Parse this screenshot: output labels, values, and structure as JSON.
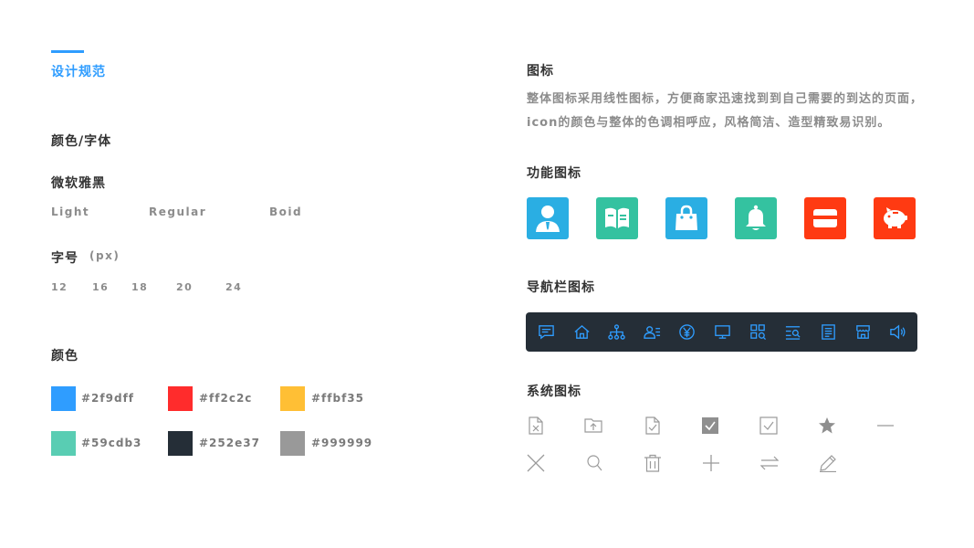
{
  "page": {
    "title": "设计规范"
  },
  "left": {
    "section_color_font": "颜色/字体",
    "font_name": "微软雅黑",
    "weights": [
      "Light",
      "Regular",
      "Boid"
    ],
    "size_title": "字号",
    "size_unit": "(px)",
    "sizes": [
      "12",
      "16",
      "18",
      "20",
      "24"
    ],
    "section_colors": "颜色",
    "colors": [
      {
        "hex": "#2f9dff",
        "label": "#2f9dff"
      },
      {
        "hex": "#ff2c2c",
        "label": "#ff2c2c"
      },
      {
        "hex": "#ffbf35",
        "label": "#ffbf35"
      },
      {
        "hex": "#59cdb3",
        "label": "#59cdb3"
      },
      {
        "hex": "#252e37",
        "label": "#252e37"
      },
      {
        "hex": "#999999",
        "label": "#999999"
      }
    ]
  },
  "right": {
    "section_icons": "图标",
    "desc_line1": "整体图标采用线性图标，方便商家迅速找到到自己需要的到达的页面，",
    "desc_line2": "icon的颜色与整体的色调相呼应，风格简洁、造型精致易识别。",
    "section_function": "功能图标",
    "function_icons": [
      {
        "name": "user-icon",
        "color": "#2aaee3"
      },
      {
        "name": "book-icon",
        "color": "#34c2a0"
      },
      {
        "name": "shopping-bag-icon",
        "color": "#2aaee3"
      },
      {
        "name": "bell-icon",
        "color": "#34c2a0"
      },
      {
        "name": "card-icon",
        "color": "#ff3a12"
      },
      {
        "name": "piggy-bank-icon",
        "color": "#ff3a12"
      }
    ],
    "section_nav": "导航栏图标",
    "nav_icons": [
      "message-icon",
      "home-icon",
      "org-chart-icon",
      "contacts-icon",
      "yen-icon",
      "monitor-icon",
      "apps-icon",
      "search-list-icon",
      "document-icon",
      "store-icon",
      "volume-icon"
    ],
    "nav_color": "#2f9dff",
    "section_system": "系统图标",
    "system_icons_row1": [
      "file-delete-icon",
      "folder-upload-icon",
      "file-check-icon",
      "checkbox-checked-icon",
      "checkbox-icon",
      "star-icon",
      "minus-icon"
    ],
    "system_icons_row2": [
      "close-icon",
      "search-icon",
      "trash-icon",
      "plus-icon",
      "swap-icon",
      "edit-icon"
    ]
  }
}
